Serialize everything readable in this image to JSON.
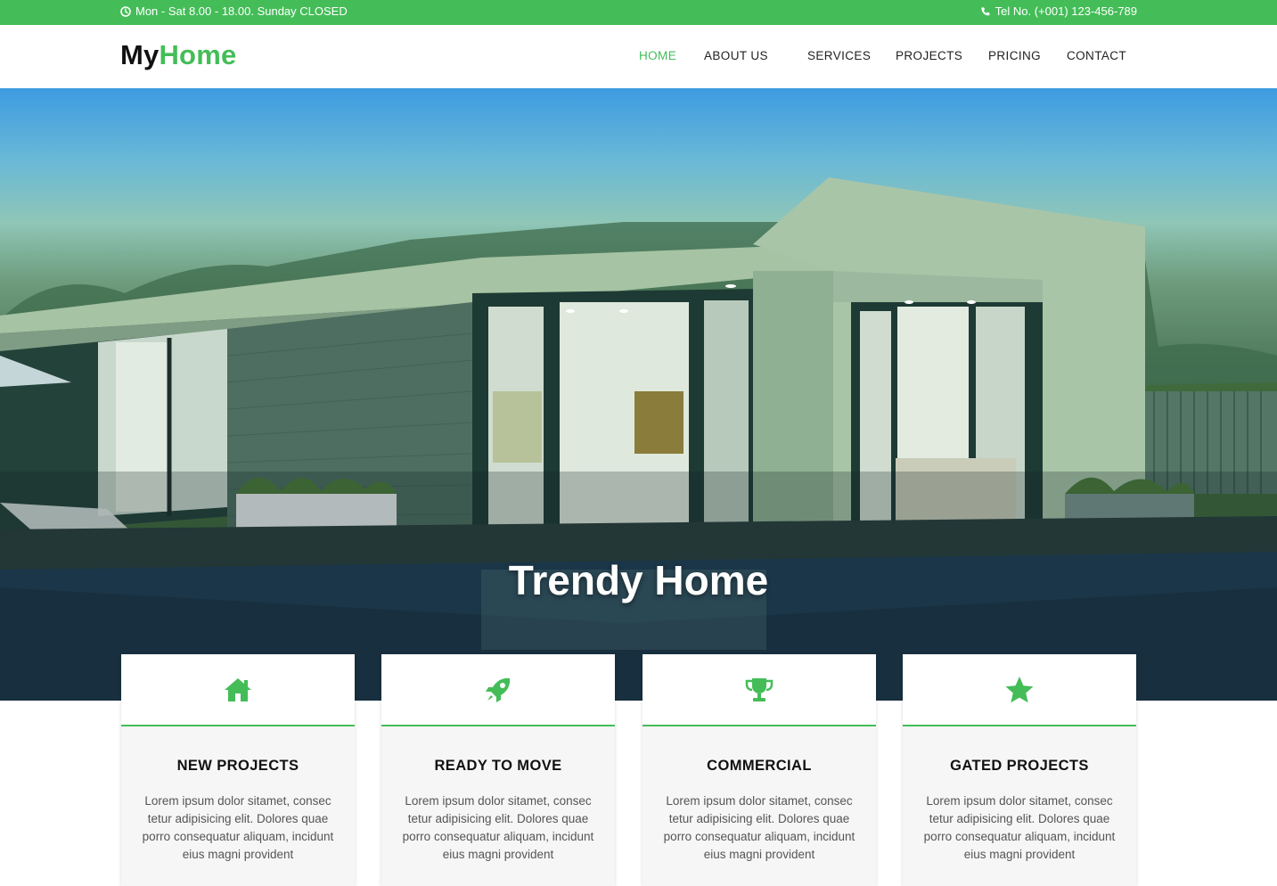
{
  "topbar": {
    "hours": "Mon - Sat 8.00 - 18.00. Sunday CLOSED",
    "hours_icon": "clock-icon",
    "phone": "Tel No. (+001) 123-456-789",
    "phone_icon": "phone-icon",
    "background": "#44bd58"
  },
  "logo": {
    "part1": "My",
    "part2": "Home"
  },
  "nav": {
    "items": [
      {
        "label": "HOME",
        "active": true
      },
      {
        "label": "ABOUT US",
        "active": false
      },
      {
        "label": "SERVICES",
        "active": false
      },
      {
        "label": "PROJECTS",
        "active": false
      },
      {
        "label": "PRICING",
        "active": false
      },
      {
        "label": "CONTACT",
        "active": false
      }
    ]
  },
  "hero": {
    "title": "Trendy Home"
  },
  "features": [
    {
      "icon": "home-icon",
      "title": "NEW PROJECTS",
      "text": "Lorem ipsum dolor sitamet, consec tetur adipisicing elit. Dolores quae porro consequatur aliquam, incidunt eius magni provident"
    },
    {
      "icon": "rocket-icon",
      "title": "READY TO MOVE",
      "text": "Lorem ipsum dolor sitamet, consec tetur adipisicing elit. Dolores quae porro consequatur aliquam, incidunt eius magni provident"
    },
    {
      "icon": "trophy-icon",
      "title": "COMMERCIAL",
      "text": "Lorem ipsum dolor sitamet, consec tetur adipisicing elit. Dolores quae porro consequatur aliquam, incidunt eius magni provident"
    },
    {
      "icon": "star-icon",
      "title": "GATED PROJECTS",
      "text": "Lorem ipsum dolor sitamet, consec tetur adipisicing elit. Dolores quae porro consequatur aliquam, incidunt eius magni provident"
    }
  ],
  "colors": {
    "accent": "#44bd58",
    "text_dark": "#111111",
    "text_muted": "#555555",
    "card_bg": "#f6f6f6"
  }
}
